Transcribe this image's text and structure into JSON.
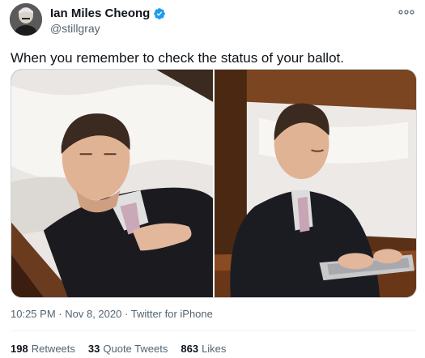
{
  "author": {
    "name": "Ian Miles Cheong",
    "handle": "@stillgray",
    "verified": true
  },
  "icons": {
    "verified": "verified-badge-icon",
    "more": "more-options-icon"
  },
  "colors": {
    "verified": "#1d9bf0",
    "secondary_text": "#536471"
  },
  "tweet": {
    "text": "When you remember to check the status of your ballot."
  },
  "media": {
    "image_count": 2
  },
  "meta": {
    "time": "10:25 PM",
    "date": "Nov 8, 2020",
    "source": "Twitter for iPhone",
    "separator": "·"
  },
  "stats": {
    "retweets_count": "198",
    "retweets_label": "Retweets",
    "quotes_count": "33",
    "quotes_label": "Quote Tweets",
    "likes_count": "863",
    "likes_label": "Likes"
  }
}
